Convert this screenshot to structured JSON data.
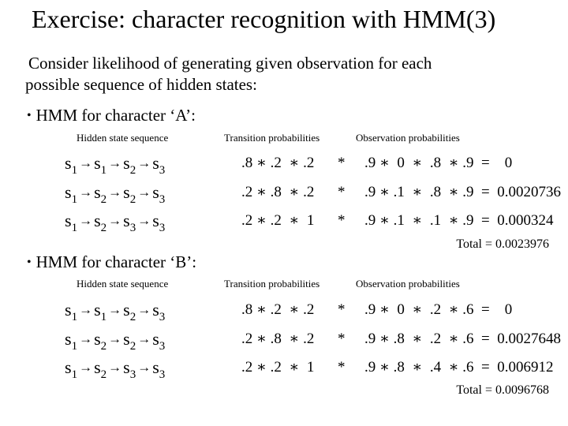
{
  "title": "Exercise: character recognition with HMM(3)",
  "intro": {
    "line1": "Consider likelihood of generating given observation for each",
    "line2": "possible sequence of hidden states:"
  },
  "column_headers": {
    "sequence": "Hidden state sequence",
    "transition": "Transition probabilities",
    "observation": "Observation probabilities"
  },
  "arrow_icon": "→",
  "star": "*",
  "sections": [
    {
      "bullet": "•",
      "heading": "HMM for character ‘A’:",
      "rows": [
        {
          "states": [
            "1",
            "1",
            "2",
            "3"
          ],
          "transition": ".8 ∗ .2  ∗ .2",
          "observation": ".9 ∗  0  ∗  .8  ∗ .9  =    0"
        },
        {
          "states": [
            "1",
            "2",
            "2",
            "3"
          ],
          "transition": ".2 ∗ .8  ∗ .2",
          "observation": ".9 ∗ .1  ∗  .8  ∗ .9  =  0.0020736"
        },
        {
          "states": [
            "1",
            "2",
            "3",
            "3"
          ],
          "transition": ".2 ∗ .2  ∗  1",
          "observation": ".9 ∗ .1  ∗  .1  ∗ .9  =  0.000324"
        }
      ],
      "total_label": "Total",
      "total_value": "=  0.0023976"
    },
    {
      "bullet": "•",
      "heading": "HMM for character ‘B’:",
      "rows": [
        {
          "states": [
            "1",
            "1",
            "2",
            "3"
          ],
          "transition": ".8 ∗ .2  ∗ .2",
          "observation": ".9 ∗  0  ∗  .2  ∗ .6  =    0"
        },
        {
          "states": [
            "1",
            "2",
            "2",
            "3"
          ],
          "transition": ".2 ∗ .8  ∗ .2",
          "observation": ".9 ∗ .8  ∗  .2  ∗ .6  =  0.0027648"
        },
        {
          "states": [
            "1",
            "2",
            "3",
            "3"
          ],
          "transition": ".2 ∗ .2  ∗  1",
          "observation": ".9 ∗ .8  ∗  .4  ∗ .6  =  0.006912"
        }
      ],
      "total_label": "Total",
      "total_value": "=  0.0096768"
    }
  ]
}
